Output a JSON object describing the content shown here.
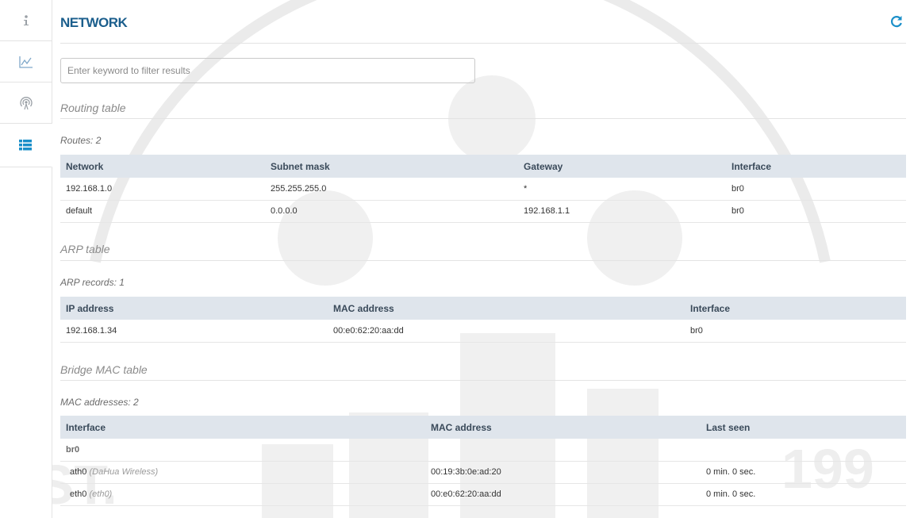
{
  "sidebar": {
    "items": [
      {
        "icon": "info-icon",
        "active": false
      },
      {
        "icon": "chart-icon",
        "active": false
      },
      {
        "icon": "wireless-icon",
        "active": false
      },
      {
        "icon": "list-icon",
        "active": true
      }
    ]
  },
  "header": {
    "title": "NETWORK",
    "refresh_icon": "refresh-icon"
  },
  "filter": {
    "placeholder": "Enter keyword to filter results",
    "value": ""
  },
  "routing": {
    "title": "Routing table",
    "count": "Routes: 2",
    "columns": [
      "Network",
      "Subnet mask",
      "Gateway",
      "Interface"
    ],
    "rows": [
      [
        "192.168.1.0",
        "255.255.255.0",
        "*",
        "br0"
      ],
      [
        "default",
        "0.0.0.0",
        "192.168.1.1",
        "br0"
      ]
    ]
  },
  "arp": {
    "title": "ARP table",
    "count": "ARP records: 1",
    "columns": [
      "IP address",
      "MAC address",
      "Interface"
    ],
    "rows": [
      [
        "192.168.1.34",
        "00:e0:62:20:aa:dd",
        "br0"
      ]
    ]
  },
  "bridge": {
    "title": "Bridge MAC table",
    "count": "MAC addresses: 2",
    "columns": [
      "Interface",
      "MAC address",
      "Last seen"
    ],
    "group": "br0",
    "rows": [
      {
        "iface": "ath0",
        "desc": "(DaHua Wireless)",
        "mac": "00:19:3b:0e:ad:20",
        "seen": "0 min. 0 sec."
      },
      {
        "iface": "eth0",
        "desc": "(eth0)",
        "mac": "00:e0:62:20:aa:dd",
        "seen": "0 min. 0 sec."
      }
    ]
  },
  "colors": {
    "title": "#1b5e8c",
    "accent": "#1a8fc9",
    "header_bg": "#dfe5ec"
  }
}
